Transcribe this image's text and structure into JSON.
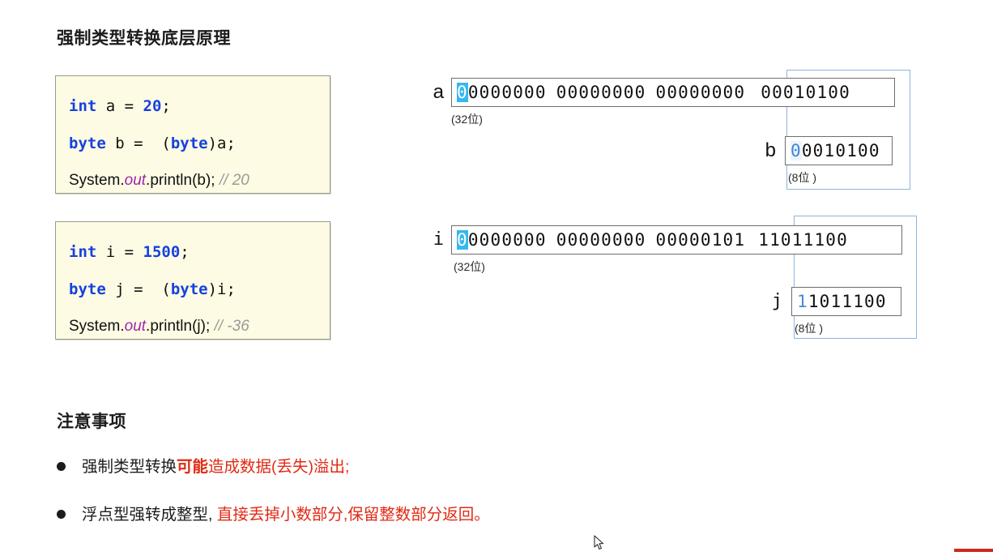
{
  "page": {
    "title": "强制类型转换底层原理",
    "notes_title": "注意事项",
    "accent_red": "#e12a14",
    "accent_blue": "#3d86d8",
    "highlight_cyan": "#35b8ef",
    "code_bg": "#fdfbe3"
  },
  "code_blocks": [
    {
      "id": "code-box-1",
      "lines": [
        {
          "kw": "int",
          "sp1": " a = ",
          "num": "20",
          "tail": ";"
        },
        {
          "kw": "byte",
          "sp1": " b =  (",
          "kw2": "byte",
          "tail": ")a;"
        },
        {
          "pre": "System.",
          "italic": "out",
          "mid": ".println(b); ",
          "comment": "// 20"
        }
      ]
    },
    {
      "id": "code-box-2",
      "lines": [
        {
          "kw": "int",
          "sp1": " i = ",
          "num": "1500",
          "tail": ";"
        },
        {
          "kw": "byte",
          "sp1": " j =  (",
          "kw2": "byte",
          "tail": ")i;"
        },
        {
          "pre": "System.",
          "italic": "out",
          "mid": ".println(j); ",
          "comment": "// -36"
        }
      ]
    }
  ],
  "diagrams": [
    {
      "id": "diagram-1",
      "wide": {
        "label": "a",
        "bits_hi": "0",
        "bits_rest": "0000000",
        "group2": "00000000",
        "group3": "00000000",
        "group4": "00010100",
        "width_note": "(32位)"
      },
      "narrow": {
        "label": "b",
        "bits_hi": "0",
        "bits_rest": "0010100",
        "width_note": "(8位 )"
      }
    },
    {
      "id": "diagram-2",
      "wide": {
        "label": "i",
        "bits_hi": "0",
        "bits_rest": "0000000",
        "group2": "00000000",
        "group3": "00000101",
        "group4": "11011100",
        "width_note": "(32位)"
      },
      "narrow": {
        "label": "j",
        "bits_hi": "1",
        "bits_rest": "1011100",
        "width_note": "(8位 )"
      }
    }
  ],
  "notes": [
    {
      "bullet": "●",
      "plain1": "强制类型转换",
      "red_bold": "可能",
      "red_rest": "造成数据(丢失)溢出;"
    },
    {
      "bullet": "●",
      "plain1": "浮点型强转成整型,",
      "red_bold": "",
      "red_rest": " 直接丢掉小数部分,保留整数部分返回。"
    }
  ]
}
